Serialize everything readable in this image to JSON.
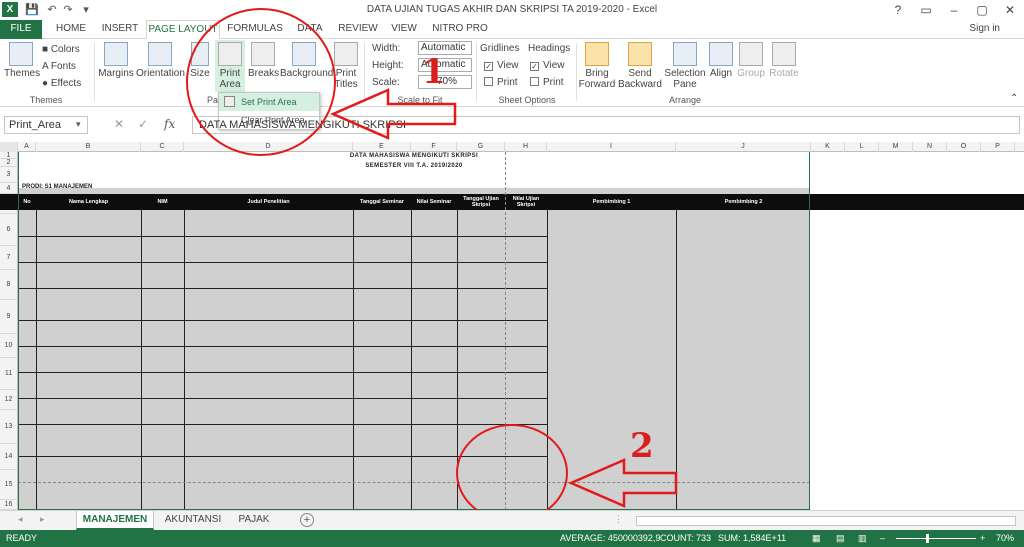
{
  "window": {
    "title": "DATA UJIAN TUGAS AKHIR DAN SKRIPSI TA 2019-2020 - Excel",
    "buttons": [
      "?",
      "▭",
      "–",
      "▢",
      "✕"
    ]
  },
  "tabs": [
    "FILE",
    "HOME",
    "INSERT",
    "PAGE LAYOUT",
    "FORMULAS",
    "DATA",
    "REVIEW",
    "VIEW",
    "NITRO PRO"
  ],
  "active_tab": "PAGE LAYOUT",
  "signin": "Sign in",
  "ribbon": {
    "themes": {
      "themes_label": "Themes",
      "colors": "Colors",
      "fonts": "Fonts",
      "effects": "Effects",
      "group": "Themes"
    },
    "page_setup": {
      "margins": "Margins",
      "orientation": "Orientation",
      "size": "Size",
      "print_area_1": "Print",
      "print_area_2": "Area",
      "breaks": "Breaks",
      "background": "Background",
      "print_titles_1": "Print",
      "print_titles_2": "Titles",
      "group": "Pag"
    },
    "scale": {
      "width_label": "Width:",
      "width_value": "Automatic",
      "height_label": "Height:",
      "height_value": "Automatic",
      "scale_label": "Scale:",
      "scale_value": "70%",
      "group": "Scale to Fit"
    },
    "sheet_options": {
      "gridlines": "Gridlines",
      "headings": "Headings",
      "view": "View",
      "print": "Print",
      "group": "Sheet Options",
      "check": "✓"
    },
    "arrange": {
      "bring_forward_1": "Bring",
      "bring_forward_2": "Forward",
      "send_backward_1": "Send",
      "send_backward_2": "Backward",
      "selection_pane_1": "Selection",
      "selection_pane_2": "Pane",
      "align": "Align",
      "group_btn": "Group",
      "rotate": "Rotate",
      "group": "Arrange"
    }
  },
  "print_menu": {
    "set": "Set Print Area",
    "clear": "Clear Print Area"
  },
  "formula_bar": {
    "name_box": "Print_Area",
    "fx": "fx",
    "content": "DATA MAHASISWA MENGIKUTI SKRIPSI"
  },
  "columns": [
    "A",
    "B",
    "C",
    "D",
    "E",
    "F",
    "G",
    "H",
    "I",
    "J",
    "K",
    "L",
    "M",
    "N",
    "O",
    "P"
  ],
  "rows": [
    "1",
    "2",
    "3",
    "4",
    "5",
    "6",
    "7",
    "8",
    "9",
    "10",
    "11",
    "12",
    "13",
    "14",
    "15",
    "16"
  ],
  "sheet": {
    "title": "DATA MAHASISWA MENGIKUTI SKRIPSI",
    "subtitle": "SEMESTER VIII T.A. 2019/2020",
    "prodi": "PRODI: S1 MANAJEMEN",
    "headers": [
      "No",
      "Nama Lengkap",
      "NIM",
      "Judul Penelitian",
      "Tanggal Seminar",
      "Nilai Seminar",
      "Tanggal Ujian Skripsi",
      "Nilai Ujian Skripsi",
      "Pembimbing 1",
      "Pembimbing 2"
    ]
  },
  "annotations": {
    "one": "1",
    "two": "2",
    "accent": "#e21a1a"
  },
  "sheet_tabs": [
    "MANAJEMEN",
    "AKUNTANSI",
    "PAJAK"
  ],
  "status": {
    "ready": "READY",
    "average": "AVERAGE: 450000392,9",
    "count": "COUNT: 733",
    "sum": "SUM: 1,584E+11",
    "zoom": "70%"
  },
  "colors": {
    "excel_green": "#217346"
  }
}
